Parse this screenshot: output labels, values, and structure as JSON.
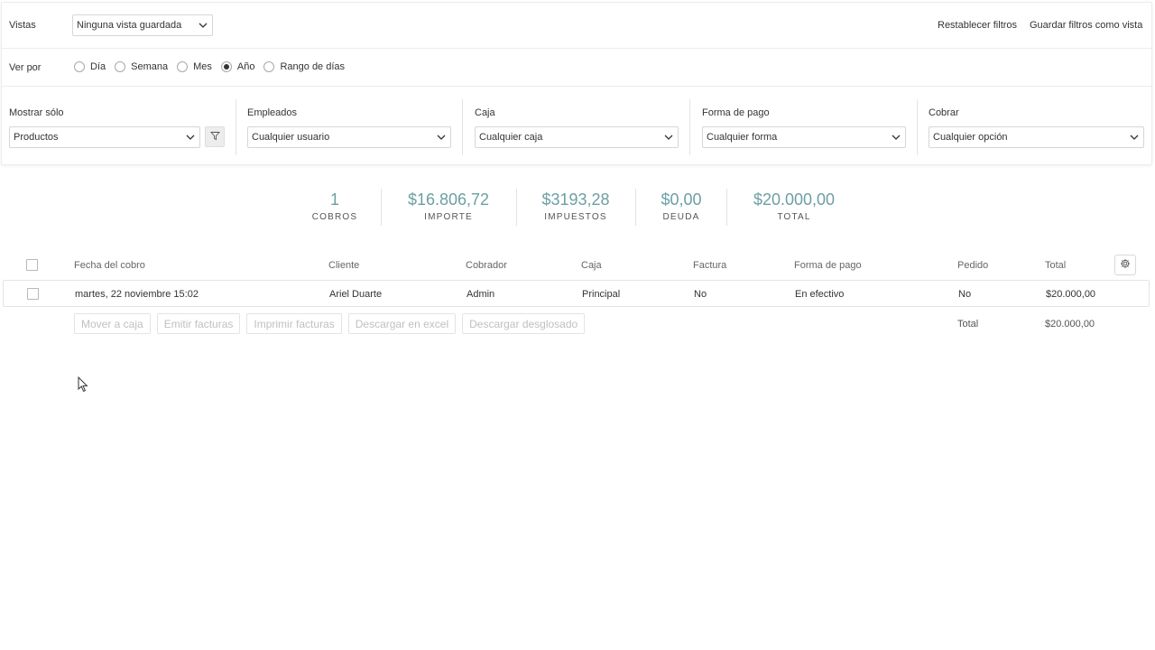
{
  "views": {
    "label": "Vistas",
    "selected": "Ninguna vista guardada",
    "reset_link": "Restablecer filtros",
    "save_link": "Guardar filtros como vista"
  },
  "view_by": {
    "label": "Ver por",
    "options": [
      "Día",
      "Semana",
      "Mes",
      "Año",
      "Rango de días"
    ],
    "selected": "Año"
  },
  "filters": {
    "show_only": {
      "label": "Mostrar sólo",
      "value": "Productos"
    },
    "employees": {
      "label": "Empleados",
      "value": "Cualquier usuario"
    },
    "register": {
      "label": "Caja",
      "value": "Cualquier caja"
    },
    "payment_method": {
      "label": "Forma de pago",
      "value": "Cualquier forma"
    },
    "charge": {
      "label": "Cobrar",
      "value": "Cualquier opción"
    }
  },
  "stats": [
    {
      "value": "1",
      "label": "COBROS"
    },
    {
      "value": "$16.806,72",
      "label": "IMPORTE"
    },
    {
      "value": "$3193,28",
      "label": "IMPUESTOS"
    },
    {
      "value": "$0,00",
      "label": "DEUDA"
    },
    {
      "value": "$20.000,00",
      "label": "TOTAL"
    }
  ],
  "table": {
    "headers": [
      "Fecha del cobro",
      "Cliente",
      "Cobrador",
      "Caja",
      "Factura",
      "Forma de pago",
      "Pedido",
      "Total"
    ],
    "rows": [
      [
        "martes, 22 noviembre 15:02",
        "Ariel Duarte",
        "Admin",
        "Principal",
        "No",
        "En efectivo",
        "No",
        "$20.000,00"
      ]
    ],
    "footer_label": "Total",
    "footer_total": "$20.000,00"
  },
  "actions": [
    "Mover a caja",
    "Emitir facturas",
    "Imprimir facturas",
    "Descargar en excel",
    "Descargar desglosado"
  ],
  "colors": {
    "accent": "#6c9fa3",
    "disabled_text": "#c0c0c0",
    "border": "#e4e4e4"
  }
}
